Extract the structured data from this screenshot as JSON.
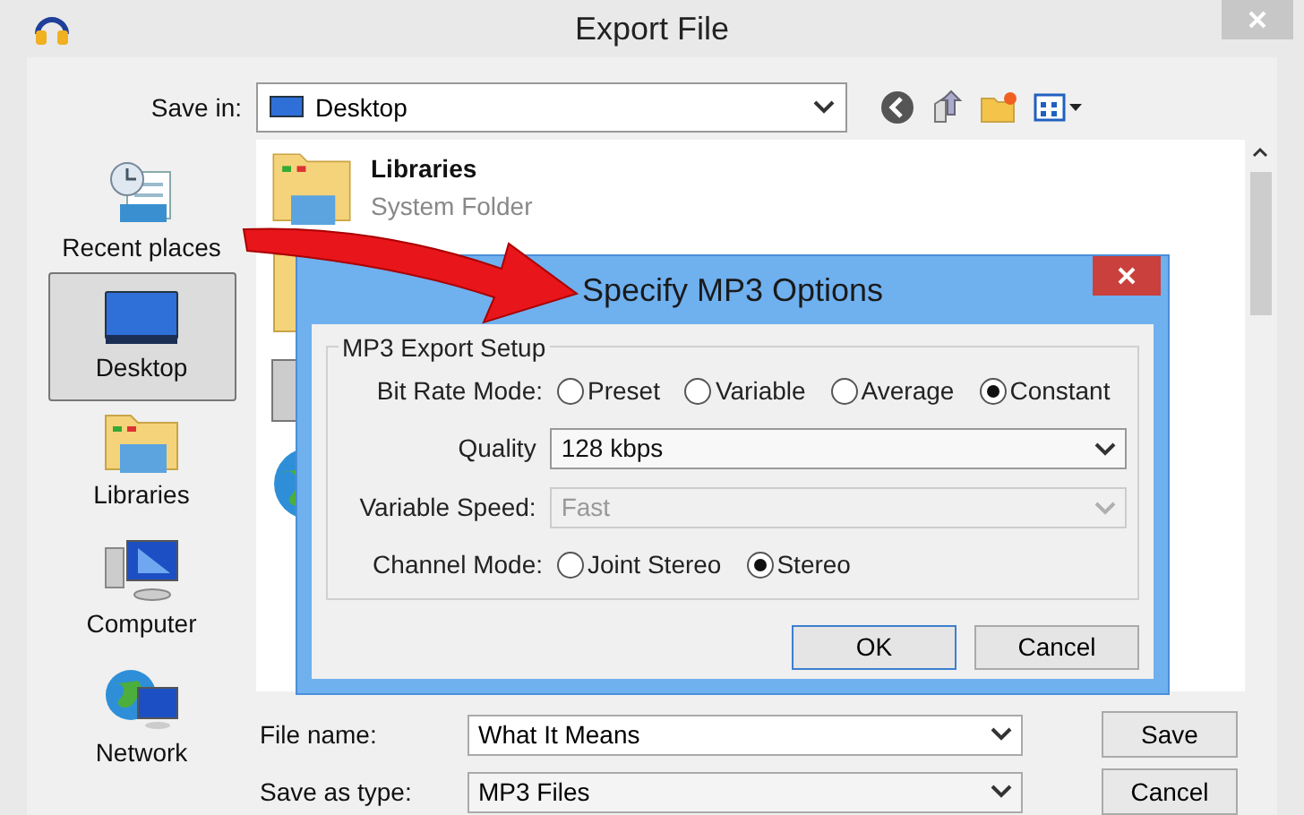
{
  "window": {
    "title": "Export File"
  },
  "save_in": {
    "label": "Save in:",
    "value": "Desktop"
  },
  "places": [
    {
      "label": "Recent places",
      "selected": false
    },
    {
      "label": "Desktop",
      "selected": true
    },
    {
      "label": "Libraries",
      "selected": false
    },
    {
      "label": "Computer",
      "selected": false
    },
    {
      "label": "Network",
      "selected": false
    }
  ],
  "files": [
    {
      "name": "Libraries",
      "type": "System Folder"
    }
  ],
  "file_name": {
    "label": "File name:",
    "value": "What It Means"
  },
  "save_as_type": {
    "label": "Save as type:",
    "value": "MP3 Files"
  },
  "buttons": [
    "Save",
    "Cancel"
  ],
  "mp3_dialog": {
    "title": "Specify MP3 Options",
    "group": "MP3 Export Setup",
    "bit_rate_mode": {
      "label": "Bit Rate Mode:",
      "options": [
        {
          "label": "Preset",
          "selected": false
        },
        {
          "label": "Variable",
          "selected": false
        },
        {
          "label": "Average",
          "selected": false
        },
        {
          "label": "Constant",
          "selected": true
        }
      ]
    },
    "quality": {
      "label": "Quality",
      "value": "128 kbps",
      "disabled": false
    },
    "variable_speed": {
      "label": "Variable Speed:",
      "value": "Fast",
      "disabled": true
    },
    "channel_mode": {
      "label": "Channel Mode:",
      "options": [
        {
          "label": "Joint Stereo",
          "selected": false
        },
        {
          "label": "Stereo",
          "selected": true
        }
      ]
    },
    "buttons": [
      {
        "label": "OK",
        "default": true
      },
      {
        "label": "Cancel",
        "default": false
      }
    ]
  }
}
